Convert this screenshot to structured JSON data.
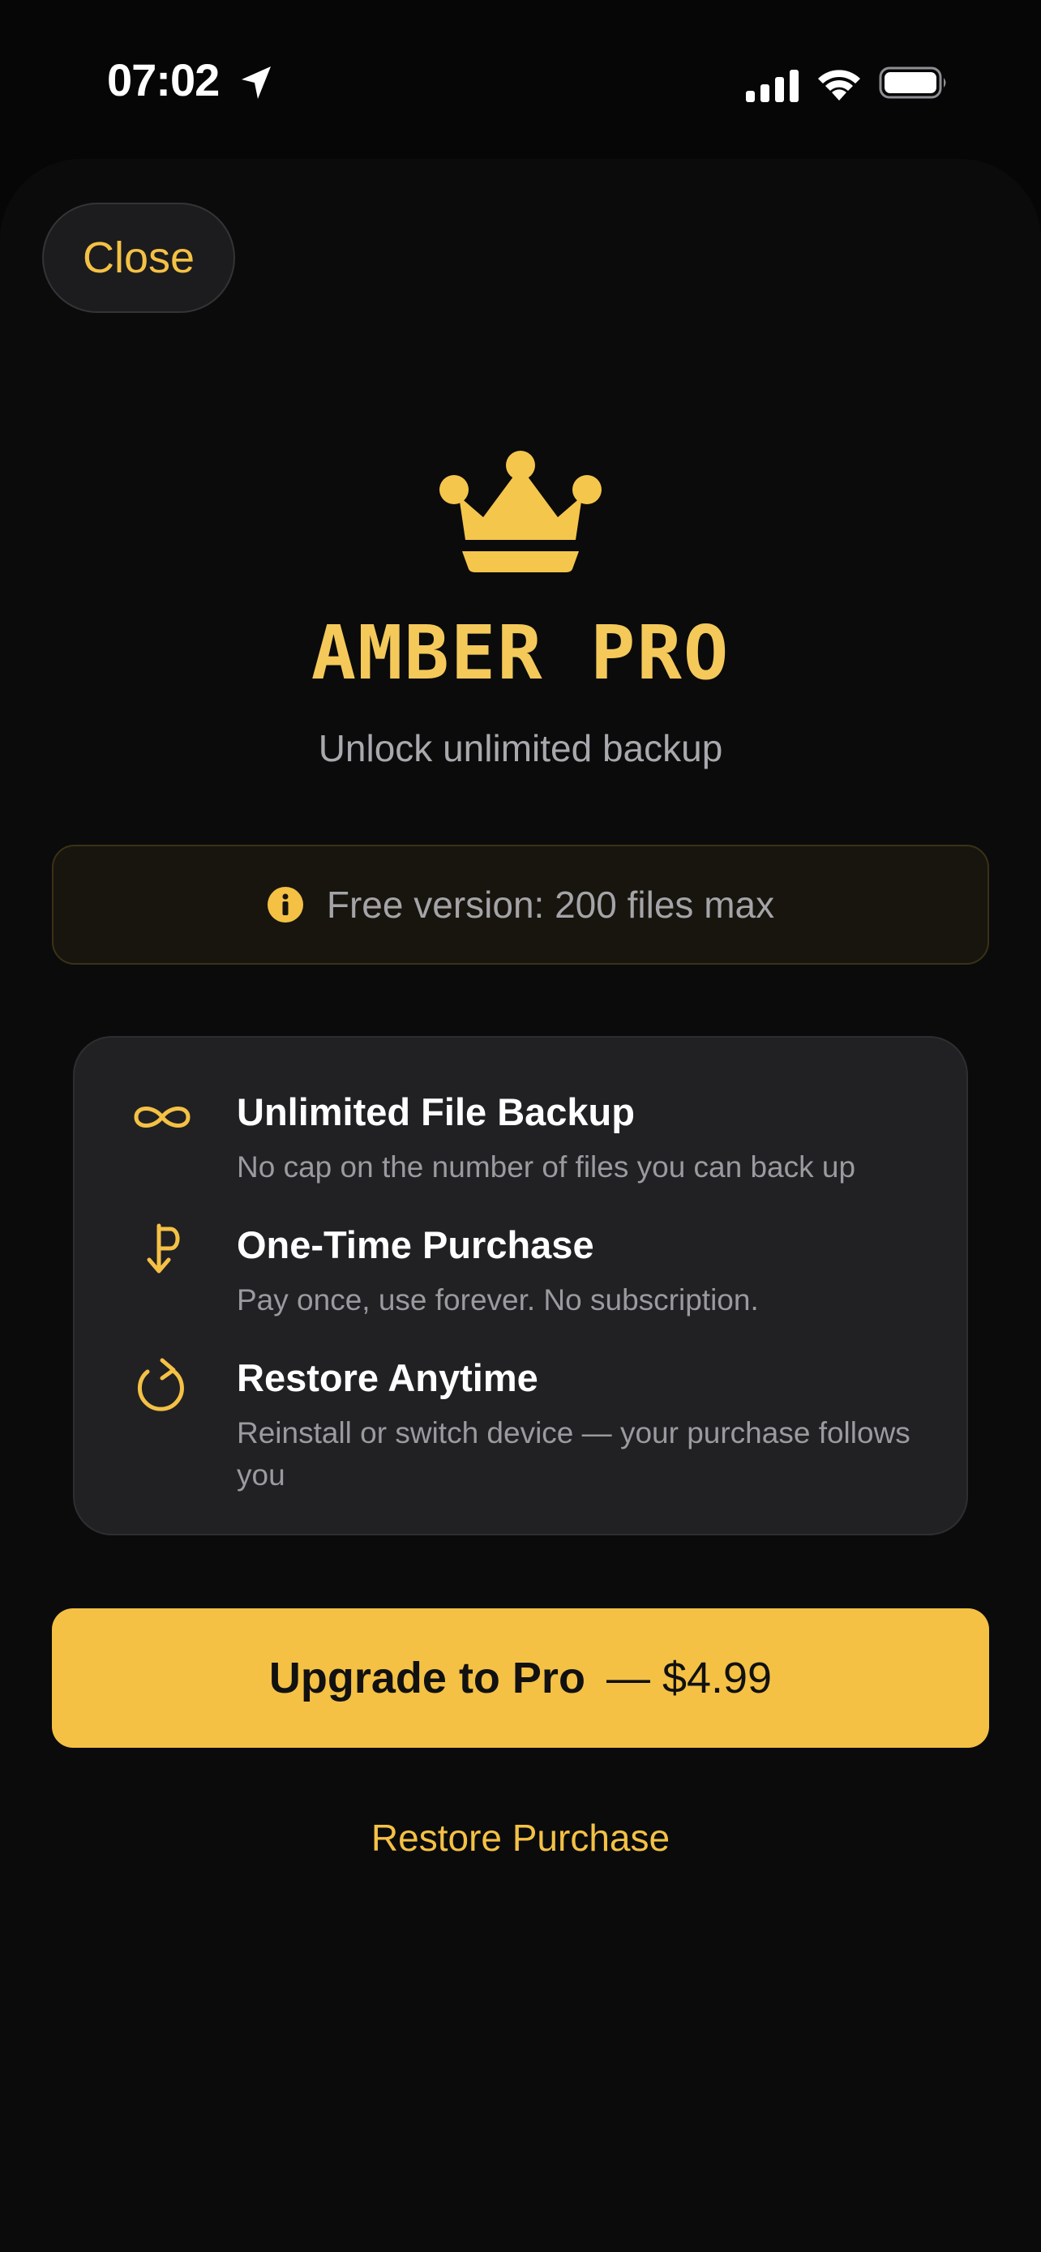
{
  "status_bar": {
    "time": "07:02",
    "icons": [
      "location-arrow-icon",
      "cellular-signal-icon",
      "wifi-icon",
      "battery-icon"
    ]
  },
  "header": {
    "close_label": "Close"
  },
  "hero": {
    "icon": "crown-icon",
    "title": "AMBER PRO",
    "subtitle": "Unlock unlimited backup"
  },
  "notice": {
    "icon": "info-icon",
    "text": "Free version: 200 files max"
  },
  "features": [
    {
      "icon": "infinity-icon",
      "title": "Unlimited File Backup",
      "description": "No cap on the number of files you can back up"
    },
    {
      "icon": "one-time-payment-icon",
      "title": "One-Time Purchase",
      "description": "Pay once, use forever. No subscription."
    },
    {
      "icon": "restore-arrow-icon",
      "title": "Restore Anytime",
      "description": "Reinstall or switch device — your purchase follows you"
    }
  ],
  "cta": {
    "label": "Upgrade to Pro",
    "price": "— $4.99"
  },
  "restore_label": "Restore Purchase",
  "colors": {
    "accent": "#f4c145",
    "background": "#0b0b0c",
    "card": "#212124"
  }
}
